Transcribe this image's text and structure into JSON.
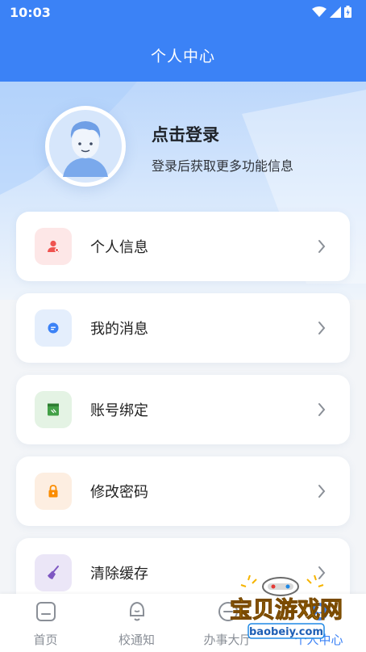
{
  "status_bar": {
    "time": "10:03"
  },
  "header": {
    "title": "个人中心"
  },
  "profile": {
    "login_title": "点击登录",
    "login_subtitle": "登录后获取更多功能信息"
  },
  "menu": [
    {
      "label": "个人信息",
      "icon": "user-icon",
      "color": "#ef5350"
    },
    {
      "label": "我的消息",
      "icon": "message-icon",
      "color": "#3b82f6"
    },
    {
      "label": "账号绑定",
      "icon": "bind-icon",
      "color": "#43a047"
    },
    {
      "label": "修改密码",
      "icon": "lock-icon",
      "color": "#fb8c00"
    },
    {
      "label": "清除缓存",
      "icon": "broom-icon",
      "color": "#7e57c2"
    }
  ],
  "bottom_nav": [
    {
      "label": "首页",
      "icon": "home-icon"
    },
    {
      "label": "校通知",
      "icon": "bell-icon"
    },
    {
      "label": "办事大厅",
      "icon": "service-icon"
    },
    {
      "label": "个人中心",
      "icon": "person-icon",
      "active": true
    }
  ],
  "watermark": {
    "text": "宝贝游戏网",
    "url": "baobeiy.com"
  },
  "colors": {
    "primary": "#3b82f6"
  }
}
